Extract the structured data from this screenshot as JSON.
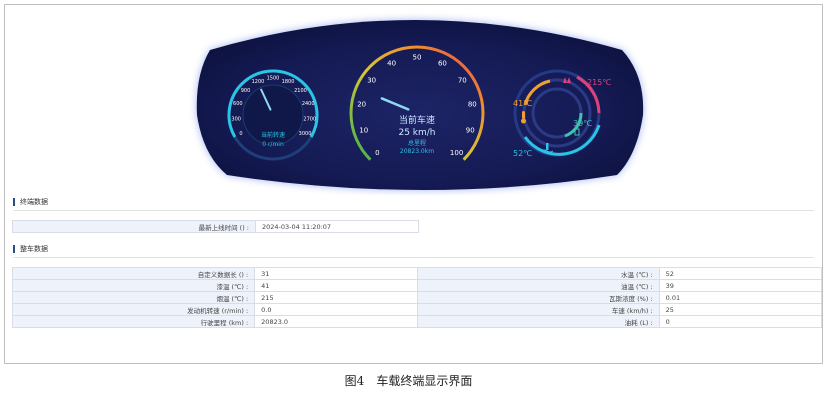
{
  "dashboard": {
    "rpm": {
      "ticks": [
        "0",
        "300",
        "600",
        "900",
        "1200",
        "1500",
        "1800",
        "2100",
        "2400",
        "2700",
        "3000"
      ],
      "label": "当前转速",
      "value_text": "0 r/min",
      "value": 0
    },
    "speed": {
      "ticks": [
        "0",
        "10",
        "20",
        "30",
        "40",
        "50",
        "60",
        "70",
        "80",
        "90",
        "100"
      ],
      "label": "当前车速",
      "value_text": "25 km/h",
      "odo_label": "总里程",
      "odo_value": "20823.0km",
      "value": 25
    },
    "temps": {
      "exhaust": "215℃",
      "oil": "41℃",
      "fuel": "39℃",
      "water": "52℃"
    },
    "colors": {
      "panel": "#141a52",
      "accent": "#29c4e6",
      "speed_low": "#3fb24a",
      "speed_high": "#e23a5a"
    }
  },
  "terminal": {
    "title": "终端数据",
    "rows": [
      {
        "label": "最新上线时间 () :",
        "value": "2024-03-04 11:20:07"
      }
    ]
  },
  "vehicle": {
    "title": "整车数据",
    "rows": [
      {
        "l_label": "自定义数据长 () :",
        "l_value": "31",
        "r_label": "水温 (℃) :",
        "r_value": "52"
      },
      {
        "l_label": "漆温 (℃) :",
        "l_value": "41",
        "r_label": "油温 (℃) :",
        "r_value": "39"
      },
      {
        "l_label": "烟温 (℃) :",
        "l_value": "215",
        "r_label": "瓦斯浓度 (%) :",
        "r_value": "0.01"
      },
      {
        "l_label": "发动机转速 (r/min) :",
        "l_value": "0.0",
        "r_label": "车速 (km/h) :",
        "r_value": "25"
      },
      {
        "l_label": "行驶里程 (km) :",
        "l_value": "20823.0",
        "r_label": "油耗 (L) :",
        "r_value": "0"
      }
    ]
  },
  "caption": {
    "figure": "图4",
    "text": "车载终端显示界面"
  }
}
